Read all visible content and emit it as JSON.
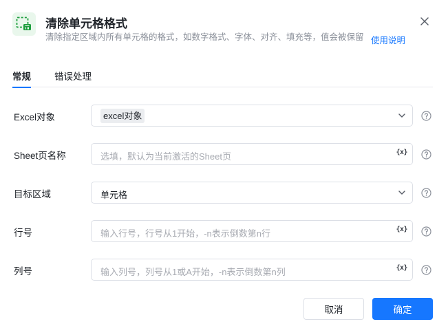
{
  "header": {
    "title": "清除单元格格式",
    "description": "清除指定区域内所有单元格的格式，如数字格式、字体、对齐、填充等，值会被保留",
    "help_link": "使用说明",
    "icon": "clear-cell-format-icon",
    "accent": "#1e9e3e"
  },
  "tabs": [
    {
      "label": "常规",
      "active": true
    },
    {
      "label": "错误处理",
      "active": false
    }
  ],
  "form": {
    "excel": {
      "label": "Excel对象",
      "value": "excel对象"
    },
    "sheet": {
      "label": "Sheet页名称",
      "placeholder": "选填，默认为当前激活的Sheet页"
    },
    "range": {
      "label": "目标区域",
      "value": "单元格"
    },
    "row": {
      "label": "行号",
      "placeholder": "输入行号，行号从1开始，-n表示倒数第n行"
    },
    "col": {
      "label": "列号",
      "placeholder": "输入列号，列号从1或A开始，-n表示倒数第n列"
    },
    "var_button": "{x}"
  },
  "footer": {
    "cancel": "取消",
    "ok": "确定"
  },
  "colors": {
    "primary": "#1677ff",
    "border": "#dcdfe6",
    "placeholder": "#a8abb2"
  }
}
